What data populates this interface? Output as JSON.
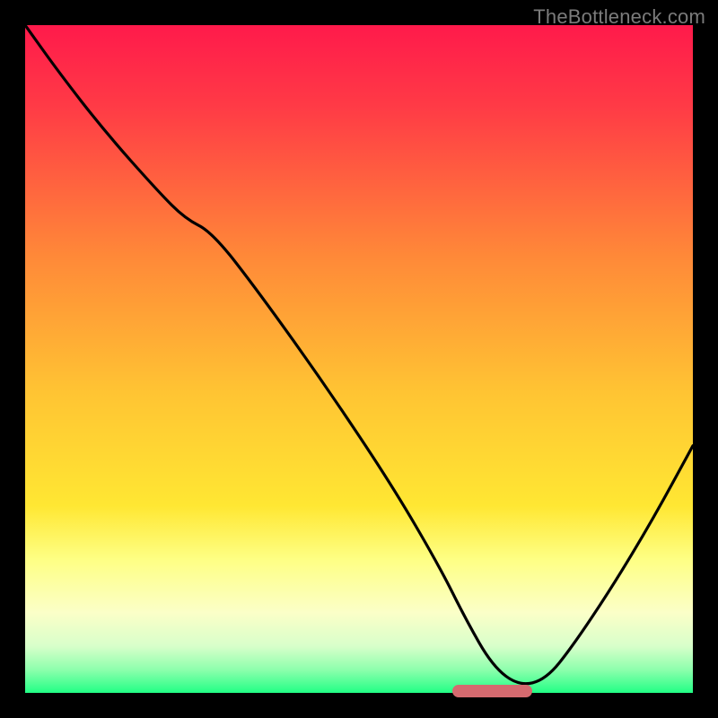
{
  "watermark": "TheBottleneck.com",
  "colors": {
    "black": "#000000",
    "red_top": "#ff1a4b",
    "red_mid": "#ff4a43",
    "orange": "#ff9a36",
    "yellow": "#ffe431",
    "pale_yellow": "#feff9c",
    "cream": "#f6ffd5",
    "green": "#2dff8a",
    "marker": "#d56a6f",
    "curve": "#000000",
    "watermark_text": "#7b7b7b"
  },
  "chart_data": {
    "type": "line",
    "title": "",
    "xlabel": "",
    "ylabel": "",
    "xlim": [
      0,
      100
    ],
    "ylim": [
      0,
      100
    ],
    "grid": false,
    "legend": false,
    "series": [
      {
        "name": "bottleneck-curve",
        "x": [
          0,
          5,
          12,
          20,
          24,
          28,
          35,
          45,
          55,
          62,
          66,
          70,
          74,
          78,
          82,
          88,
          94,
          100
        ],
        "y": [
          100,
          93,
          84,
          75,
          71,
          69,
          60,
          46,
          31,
          19,
          11,
          4,
          1,
          2,
          7,
          16,
          26,
          37
        ]
      }
    ],
    "optimum_marker": {
      "x_start": 64,
      "x_end": 76,
      "y": 0.5
    },
    "gradient_stops": [
      {
        "pct": 0,
        "color": "#ff1a4b"
      },
      {
        "pct": 12,
        "color": "#ff3a46"
      },
      {
        "pct": 35,
        "color": "#ff8a38"
      },
      {
        "pct": 55,
        "color": "#ffc433"
      },
      {
        "pct": 72,
        "color": "#ffe733"
      },
      {
        "pct": 80,
        "color": "#feff84"
      },
      {
        "pct": 88,
        "color": "#fbffc8"
      },
      {
        "pct": 93,
        "color": "#d8ffca"
      },
      {
        "pct": 96.5,
        "color": "#8effad"
      },
      {
        "pct": 100,
        "color": "#22ff85"
      }
    ]
  }
}
